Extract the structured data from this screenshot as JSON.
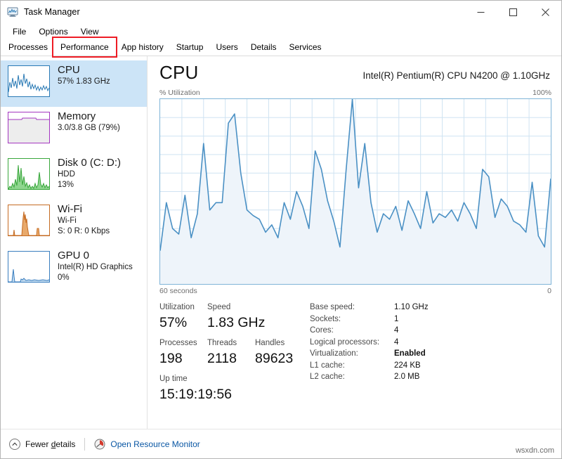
{
  "window": {
    "title": "Task Manager",
    "icon": "task-manager-icon",
    "controls": {
      "minimize": "minimize-icon",
      "maximize": "maximize-icon",
      "close": "close-icon"
    }
  },
  "menu": {
    "items": [
      "File",
      "Options",
      "View"
    ]
  },
  "tabs": {
    "items": [
      "Processes",
      "Performance",
      "App history",
      "Startup",
      "Users",
      "Details",
      "Services"
    ],
    "active": "Performance",
    "annotation_color": "#ee1c25"
  },
  "sidebar": {
    "items": [
      {
        "title": "CPU",
        "sub1": "57%  1.83 GHz",
        "sub2": "",
        "sub3": "",
        "selected": true,
        "color": "#2a7ab5",
        "graph": "cpu"
      },
      {
        "title": "Memory",
        "sub1": "3.0/3.8 GB (79%)",
        "sub2": "",
        "sub3": "",
        "selected": false,
        "color": "#a335c0",
        "graph": "memory"
      },
      {
        "title": "Disk 0 (C: D:)",
        "sub1": "HDD",
        "sub2": "13%",
        "sub3": "",
        "selected": false,
        "color": "#39a73c",
        "graph": "disk"
      },
      {
        "title": "Wi-Fi",
        "sub1": "Wi-Fi",
        "sub2": "S: 0 R: 0 Kbps",
        "sub3": "",
        "selected": false,
        "color": "#c56b22",
        "graph": "wifi"
      },
      {
        "title": "GPU 0",
        "sub1": "Intel(R) HD Graphics",
        "sub2": "0%",
        "sub3": "",
        "selected": false,
        "color": "#3a7ebf",
        "graph": "gpu"
      }
    ]
  },
  "main": {
    "heading": "CPU",
    "model": "Intel(R) Pentium(R) CPU N4200 @ 1.10GHz",
    "axis_top_left": "% Utilization",
    "axis_top_right": "100%",
    "axis_bottom_left": "60 seconds",
    "axis_bottom_right": "0",
    "stats": {
      "utilization_label": "Utilization",
      "utilization_value": "57%",
      "speed_label": "Speed",
      "speed_value": "1.83 GHz",
      "processes_label": "Processes",
      "processes_value": "198",
      "threads_label": "Threads",
      "threads_value": "2118",
      "handles_label": "Handles",
      "handles_value": "89623",
      "uptime_label": "Up time",
      "uptime_value": "15:19:19:56"
    },
    "specs": [
      {
        "label": "Base speed:",
        "value": "1.10 GHz",
        "bold": false
      },
      {
        "label": "Sockets:",
        "value": "1",
        "bold": false
      },
      {
        "label": "Cores:",
        "value": "4",
        "bold": false
      },
      {
        "label": "Logical processors:",
        "value": "4",
        "bold": false
      },
      {
        "label": "Virtualization:",
        "value": "Enabled",
        "bold": true
      },
      {
        "label": "L1 cache:",
        "value": "224 KB",
        "bold": false
      },
      {
        "label": "L2 cache:",
        "value": "2.0 MB",
        "bold": false
      }
    ]
  },
  "footer": {
    "fewer_details": "Fewer details",
    "fewer_details_icon": "chevron-up-circle-icon",
    "resource_monitor": "Open Resource Monitor",
    "resource_monitor_icon": "resource-monitor-icon",
    "link_color": "#0a57a4"
  },
  "watermark": "wsxdn.com",
  "chart_data": {
    "type": "area",
    "title": "CPU % Utilization",
    "xlabel": "60 seconds",
    "ylabel": "% Utilization",
    "ylim": [
      0,
      100
    ],
    "xlim": [
      60,
      0
    ],
    "grid": true,
    "legend": null,
    "line_color": "#4a90c4",
    "fill_color": "#eef4fa",
    "current_value": 57,
    "values": [
      18,
      44,
      30,
      27,
      48,
      25,
      38,
      76,
      40,
      44,
      44,
      87,
      92,
      60,
      40,
      37,
      35,
      28,
      32,
      25,
      44,
      35,
      50,
      42,
      30,
      72,
      62,
      45,
      34,
      20,
      62,
      100,
      52,
      76,
      44,
      28,
      38,
      35,
      42,
      29,
      45,
      38,
      30,
      50,
      33,
      38,
      36,
      40,
      34,
      44,
      38,
      30,
      62,
      58,
      36,
      46,
      42,
      34,
      32,
      28,
      55,
      26,
      20,
      57
    ]
  }
}
